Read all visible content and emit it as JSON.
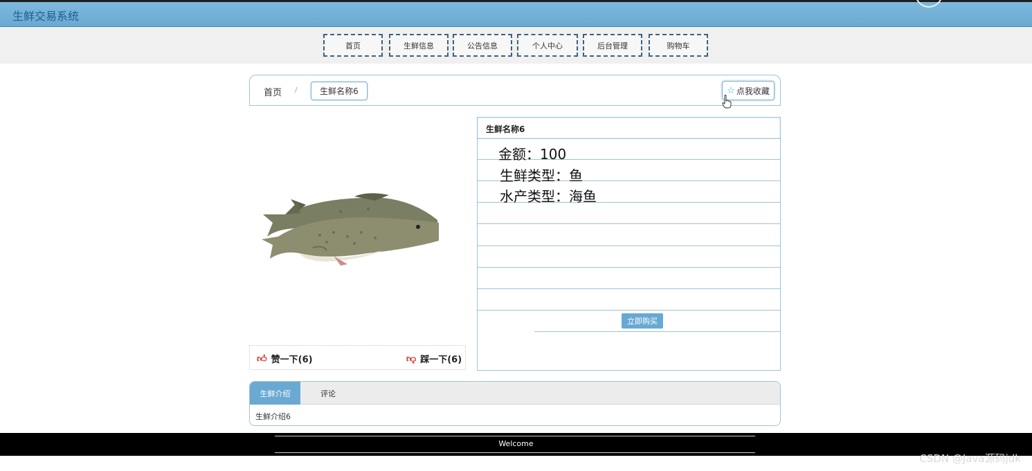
{
  "header": {
    "site_title": "生鲜交易系统"
  },
  "nav": {
    "items": [
      {
        "label": "首页"
      },
      {
        "label": "生鲜信息"
      },
      {
        "label": "公告信息"
      },
      {
        "label": "个人中心"
      },
      {
        "label": "后台管理"
      },
      {
        "label": "购物车"
      }
    ]
  },
  "breadcrumb": {
    "home": "首页",
    "separator": "/",
    "current": "生鲜名称6"
  },
  "favorite": {
    "label": "点我收藏",
    "icon": "star-outline-icon"
  },
  "product": {
    "name": "生鲜名称6",
    "image": "fish-photo",
    "amount": "金额：100",
    "fresh_type": "生鲜类型：鱼",
    "aquatic_type": "水产类型：海鱼",
    "buy_label": "立即购买"
  },
  "votes": {
    "like": "赞一下(6)",
    "dislike": "踩一下(6)"
  },
  "tabs": [
    {
      "label": "生鲜介绍",
      "active": true
    },
    {
      "label": "评论",
      "active": false
    }
  ],
  "tab_content": "生鲜介绍6",
  "footer": {
    "welcome": "Welcome"
  },
  "watermark": "CSDN @Java源码jdk",
  "colors": {
    "primary": "#6aa9d2",
    "border": "#9cc3d8",
    "nav_border": "#3d6180",
    "like_red": "#d0352b"
  }
}
